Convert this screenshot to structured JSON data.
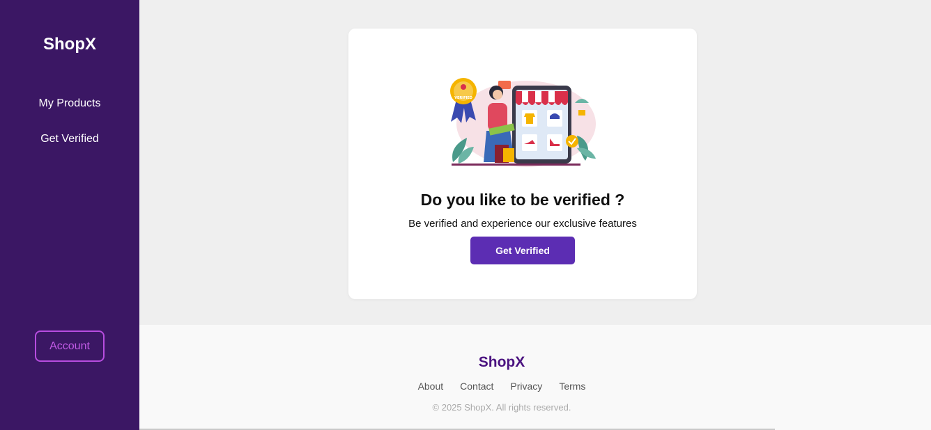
{
  "sidebar": {
    "brand": "ShopX",
    "items": [
      {
        "label": "My Products"
      },
      {
        "label": "Get Verified"
      }
    ],
    "account_label": "Account"
  },
  "card": {
    "title": "Do you like to be verified ?",
    "subtitle": "Be verified and experience our exclusive features",
    "button_label": "Get Verified",
    "badge_text": "VERIFIED"
  },
  "footer": {
    "brand": "ShopX",
    "links": [
      "About",
      "Contact",
      "Privacy",
      "Terms"
    ],
    "copyright": "© 2025 ShopX. All rights reserved."
  },
  "colors": {
    "sidebar_bg": "#3b1764",
    "primary": "#5c2db3",
    "account_border": "#b84de0",
    "footer_brand": "#4b1380"
  }
}
